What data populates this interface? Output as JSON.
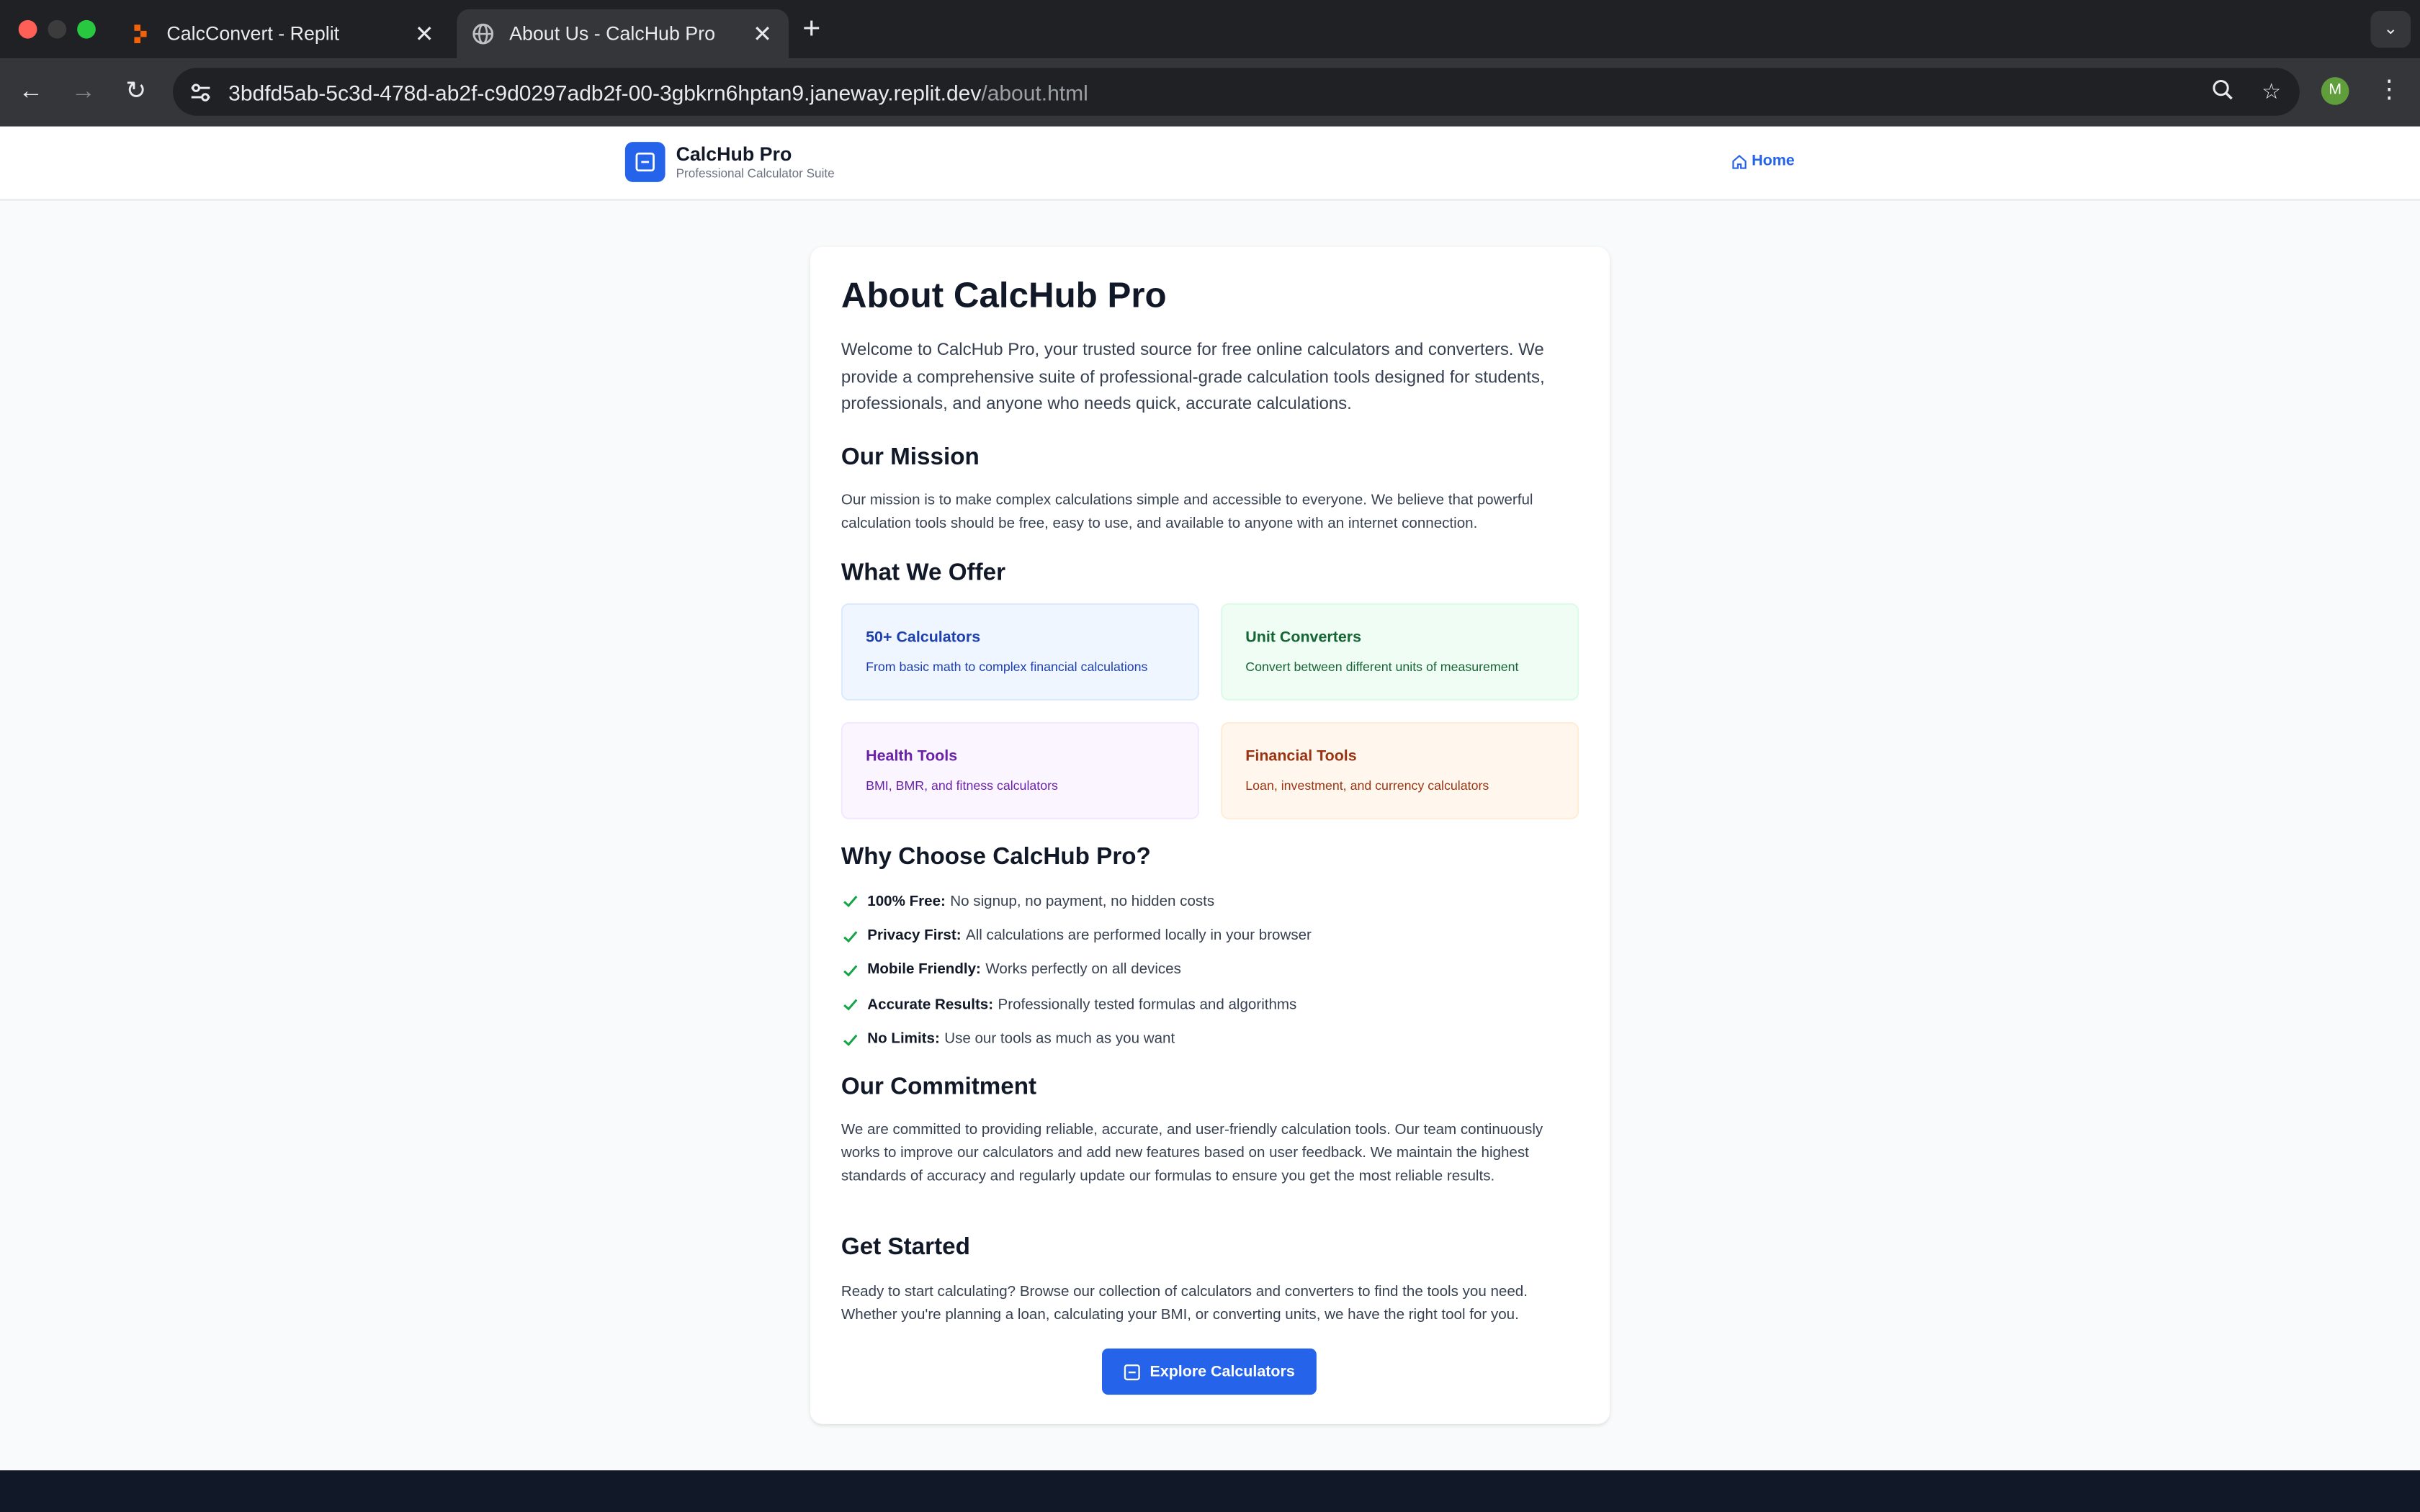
{
  "browser": {
    "tabs": [
      {
        "title": "CalcConvert - Replit",
        "active": false,
        "icon": "replit-icon"
      },
      {
        "title": "About Us - CalcHub Pro",
        "active": true,
        "icon": "globe-icon"
      }
    ],
    "url_host": "3bdfd5ab-5c3d-478d-ab2f-c9d0297adb2f-00-3gbkrn6hptan9.janeway.replit.dev",
    "url_path": "/about.html",
    "profile_initial": "M"
  },
  "header": {
    "brand_name": "CalcHub Pro",
    "brand_tagline": "Professional Calculator Suite",
    "home_label": "Home"
  },
  "about": {
    "title": "About CalcHub Pro",
    "intro": "Welcome to CalcHub Pro, your trusted source for free online calculators and converters. We provide a comprehensive suite of professional-grade calculation tools designed for students, professionals, and anyone who needs quick, accurate calculations.",
    "mission_heading": "Our Mission",
    "mission_text": "Our mission is to make complex calculations simple and accessible to everyone. We believe that powerful calculation tools should be free, easy to use, and available to anyone with an internet connection.",
    "offer_heading": "What We Offer",
    "offers": [
      {
        "title": "50+ Calculators",
        "desc": "From basic math to complex financial calculations"
      },
      {
        "title": "Unit Converters",
        "desc": "Convert between different units of measurement"
      },
      {
        "title": "Health Tools",
        "desc": "BMI, BMR, and fitness calculators"
      },
      {
        "title": "Financial Tools",
        "desc": "Loan, investment, and currency calculators"
      }
    ],
    "why_heading": "Why Choose CalcHub Pro?",
    "why": [
      {
        "label": "100% Free:",
        "text": "No signup, no payment, no hidden costs"
      },
      {
        "label": "Privacy First:",
        "text": "All calculations are performed locally in your browser"
      },
      {
        "label": "Mobile Friendly:",
        "text": "Works perfectly on all devices"
      },
      {
        "label": "Accurate Results:",
        "text": "Professionally tested formulas and algorithms"
      },
      {
        "label": "No Limits:",
        "text": "Use our tools as much as you want"
      }
    ],
    "commitment_heading": "Our Commitment",
    "commitment_text": "We are committed to providing reliable, accurate, and user-friendly calculation tools. Our team continuously works to improve our calculators and add new features based on user feedback. We maintain the highest standards of accuracy and regularly update our formulas to ensure you get the most reliable results.",
    "start_heading": "Get Started",
    "start_text": "Ready to start calculating? Browse our collection of calculators and converters to find the tools you need. Whether you're planning a loan, calculating your BMI, or converting units, we have the right tool for you.",
    "cta_label": "Explore Calculators"
  },
  "colors": {
    "accent": "#2563eb",
    "check": "#16a34a",
    "footer": "#111827"
  }
}
